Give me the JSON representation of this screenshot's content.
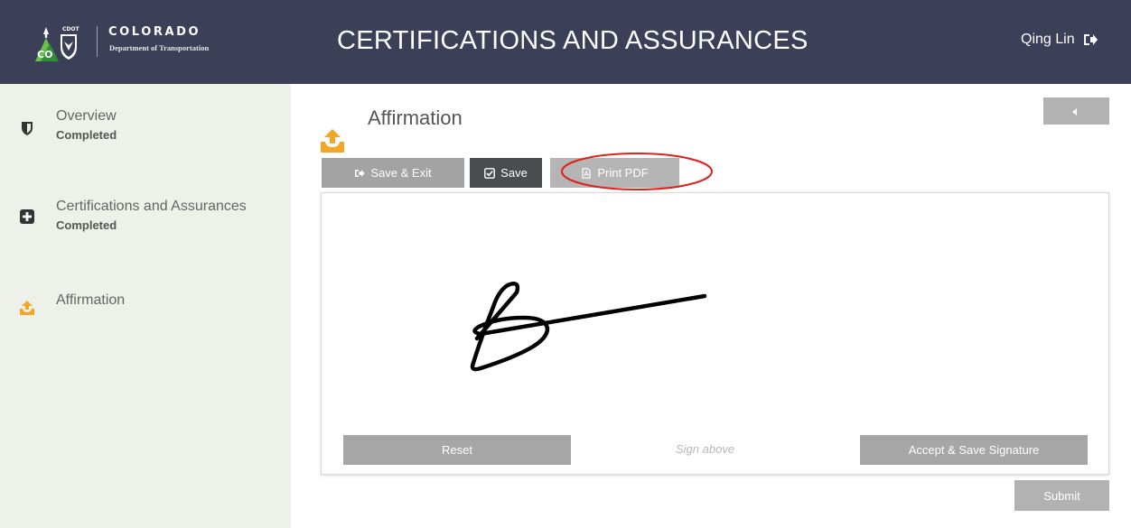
{
  "header": {
    "logo": {
      "cdot": "CDOT",
      "state": "CO",
      "name": "COLORADO",
      "department": "Department of Transportation"
    },
    "title": "CERTIFICATIONS AND ASSURANCES",
    "user_name": "Qing Lin",
    "logout_icon": "sign-out-icon",
    "background_color": "#3b3f57"
  },
  "sidebar": {
    "background_color": "#eef0ea",
    "items": [
      {
        "label": "Overview",
        "status": "Completed",
        "icon": "shield-icon"
      },
      {
        "label": "Certifications and Assurances",
        "status": "Completed",
        "icon": "plus-square-icon"
      },
      {
        "label": "Affirmation",
        "status": "",
        "icon": "upload-icon",
        "active": true
      }
    ]
  },
  "main": {
    "section_title": "Affirmation",
    "section_icon": "upload-icon",
    "accent_color": "#f5a623",
    "toolbar": {
      "save_exit_label": "Save & Exit",
      "save_label": "Save",
      "print_pdf_label": "Print PDF"
    },
    "signature_pad": {
      "reset_label": "Reset",
      "hint": "Sign above",
      "accept_label": "Accept & Save Signature"
    },
    "submit_label": "Submit",
    "annotation_color": "#e0201b"
  }
}
